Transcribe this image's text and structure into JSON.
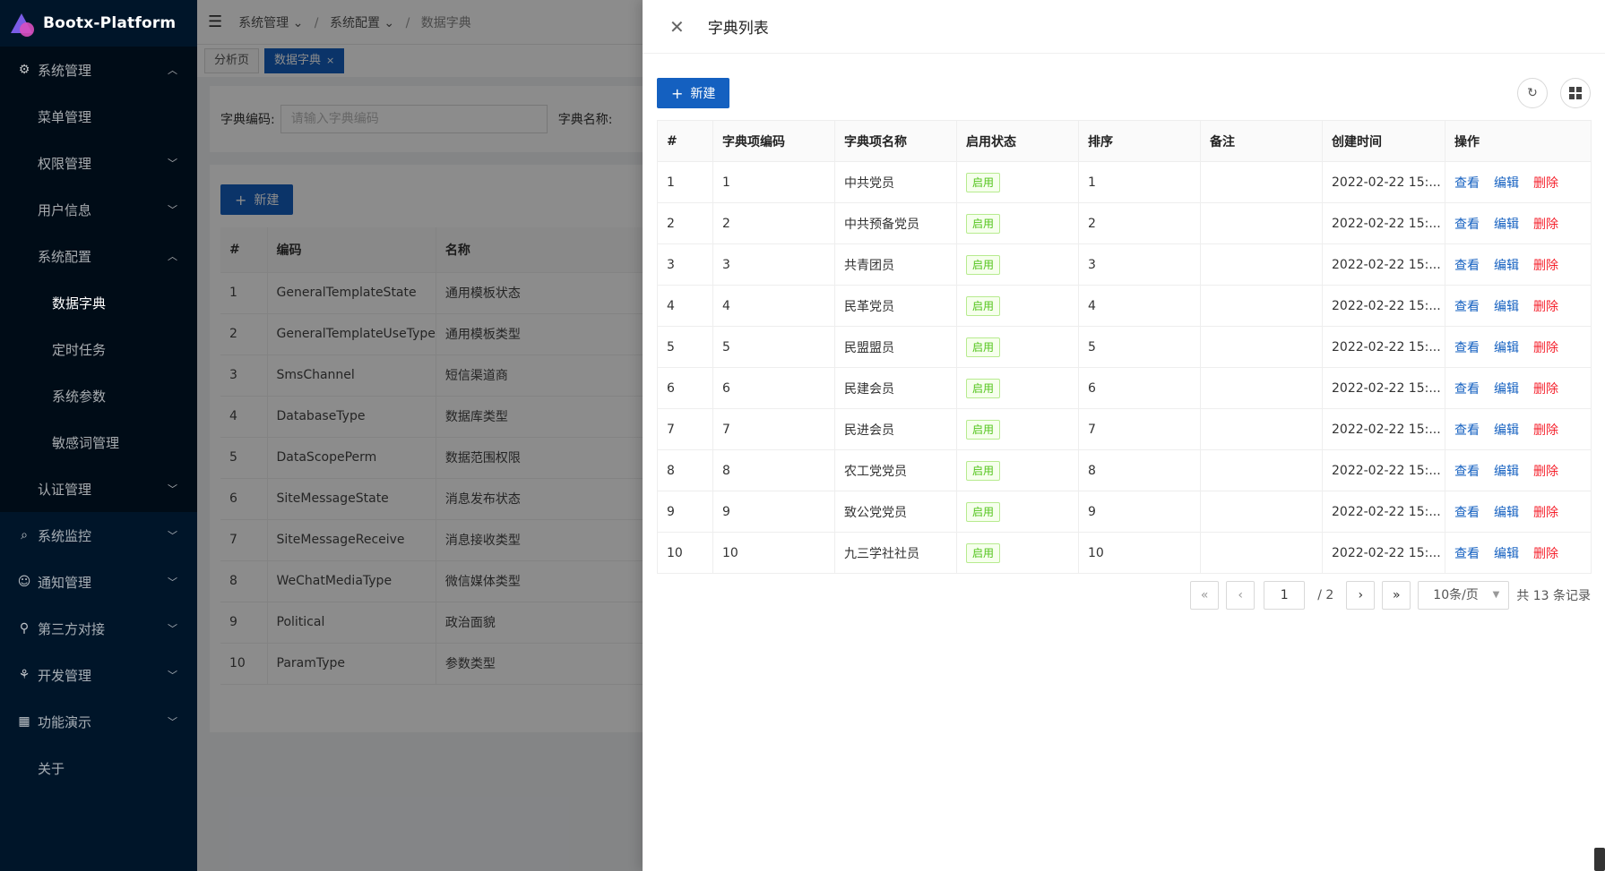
{
  "app": {
    "logo_text": "Bootx-Platform"
  },
  "sidebar": {
    "items": [
      {
        "label": "系统管理",
        "icon": "gear-icon",
        "chev": "⌃",
        "open": true
      },
      {
        "label": "菜单管理",
        "level": 1
      },
      {
        "label": "权限管理",
        "level": 1,
        "chev": "⌄"
      },
      {
        "label": "用户信息",
        "level": 1,
        "chev": "⌄"
      },
      {
        "label": "系统配置",
        "level": 1,
        "chev": "⌃"
      },
      {
        "label": "数据字典",
        "level": 2,
        "active": true
      },
      {
        "label": "定时任务",
        "level": 2
      },
      {
        "label": "系统参数",
        "level": 2
      },
      {
        "label": "敏感词管理",
        "level": 2
      },
      {
        "label": "认证管理",
        "level": 1,
        "chev": "⌄"
      },
      {
        "label": "系统监控",
        "icon": "monitor-icon",
        "chev": "⌄"
      },
      {
        "label": "通知管理",
        "icon": "notice-icon",
        "chev": "⌄"
      },
      {
        "label": "第三方对接",
        "icon": "link-icon",
        "chev": "⌄"
      },
      {
        "label": "开发管理",
        "icon": "dev-icon",
        "chev": "⌄"
      },
      {
        "label": "功能演示",
        "icon": "grid-icon",
        "chev": "⌄"
      },
      {
        "label": "关于"
      }
    ]
  },
  "header": {
    "breadcrumb": [
      "系统管理",
      "系统配置",
      "数据字典"
    ]
  },
  "tabs": [
    {
      "label": "分析页",
      "active": false
    },
    {
      "label": "数据字典",
      "active": true
    }
  ],
  "search": {
    "code_label": "字典编码:",
    "code_placeholder": "请输入字典编码",
    "name_label": "字典名称:"
  },
  "bg_table": {
    "new_label": "新建",
    "columns": [
      "#",
      "编码",
      "名称"
    ],
    "rows": [
      [
        "1",
        "GeneralTemplateState",
        "通用模板状态"
      ],
      [
        "2",
        "GeneralTemplateUseType",
        "通用模板类型"
      ],
      [
        "3",
        "SmsChannel",
        "短信渠道商"
      ],
      [
        "4",
        "DatabaseType",
        "数据库类型"
      ],
      [
        "5",
        "DataScopePerm",
        "数据范围权限"
      ],
      [
        "6",
        "SiteMessageState",
        "消息发布状态"
      ],
      [
        "7",
        "SiteMessageReceive",
        "消息接收类型"
      ],
      [
        "8",
        "WeChatMediaType",
        "微信媒体类型"
      ],
      [
        "9",
        "Political",
        "政治面貌"
      ],
      [
        "10",
        "ParamType",
        "参数类型"
      ]
    ]
  },
  "drawer": {
    "title": "字典列表",
    "new_label": "新建",
    "columns": [
      "#",
      "字典项编码",
      "字典项名称",
      "启用状态",
      "排序",
      "备注",
      "创建时间",
      "操作"
    ],
    "actions": {
      "view": "查看",
      "edit": "编辑",
      "delete": "删除"
    },
    "rows": [
      {
        "idx": "1",
        "code": "1",
        "name": "中共党员",
        "status": "启用",
        "sort": "1",
        "remark": "",
        "created": "2022-02-22 15:..."
      },
      {
        "idx": "2",
        "code": "2",
        "name": "中共预备党员",
        "status": "启用",
        "sort": "2",
        "remark": "",
        "created": "2022-02-22 15:..."
      },
      {
        "idx": "3",
        "code": "3",
        "name": "共青团员",
        "status": "启用",
        "sort": "3",
        "remark": "",
        "created": "2022-02-22 15:..."
      },
      {
        "idx": "4",
        "code": "4",
        "name": "民革党员",
        "status": "启用",
        "sort": "4",
        "remark": "",
        "created": "2022-02-22 15:..."
      },
      {
        "idx": "5",
        "code": "5",
        "name": "民盟盟员",
        "status": "启用",
        "sort": "5",
        "remark": "",
        "created": "2022-02-22 15:..."
      },
      {
        "idx": "6",
        "code": "6",
        "name": "民建会员",
        "status": "启用",
        "sort": "6",
        "remark": "",
        "created": "2022-02-22 15:..."
      },
      {
        "idx": "7",
        "code": "7",
        "name": "民进会员",
        "status": "启用",
        "sort": "7",
        "remark": "",
        "created": "2022-02-22 15:..."
      },
      {
        "idx": "8",
        "code": "8",
        "name": "农工党党员",
        "status": "启用",
        "sort": "8",
        "remark": "",
        "created": "2022-02-22 15:..."
      },
      {
        "idx": "9",
        "code": "9",
        "name": "致公党党员",
        "status": "启用",
        "sort": "9",
        "remark": "",
        "created": "2022-02-22 15:..."
      },
      {
        "idx": "10",
        "code": "10",
        "name": "九三学社社员",
        "status": "启用",
        "sort": "10",
        "remark": "",
        "created": "2022-02-22 15:..."
      }
    ],
    "pager": {
      "current": "1",
      "total_pages": "/ 2",
      "page_size": "10条/页",
      "total_text": "共 13 条记录"
    }
  },
  "colors": {
    "primary": "#1460c0",
    "sidebar_bg": "#001529",
    "danger": "#f5222d",
    "success": "#52c41a"
  }
}
